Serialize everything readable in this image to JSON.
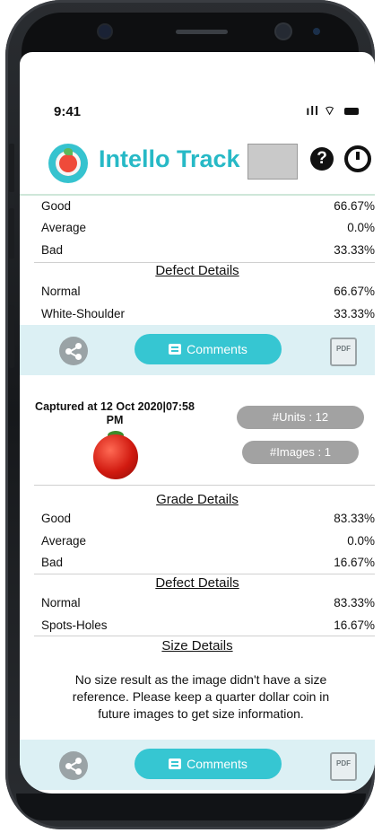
{
  "status_bar": {
    "time": "9:41",
    "signal": "ıll",
    "wifi": "⌔"
  },
  "header": {
    "app_title": "Intello Track",
    "help": "?"
  },
  "card1": {
    "grade_rows": [
      {
        "label": "Good",
        "value": "66.67%"
      },
      {
        "label": "Average",
        "value": "0.0%"
      },
      {
        "label": "Bad",
        "value": "33.33%"
      }
    ],
    "defect_title": "Defect Details",
    "defect_rows": [
      {
        "label": "Normal",
        "value": "66.67%"
      },
      {
        "label": "White-Shoulder",
        "value": "33.33%"
      }
    ],
    "comments_label": "Comments",
    "pdf_label": "PDF"
  },
  "card2": {
    "captured": "Captured at 12 Oct 2020|07:58 PM",
    "units": "#Units : 12",
    "images": "#Images : 1",
    "grade_title": "Grade Details",
    "grade_rows": [
      {
        "label": "Good",
        "value": "83.33%"
      },
      {
        "label": "Average",
        "value": "0.0%"
      },
      {
        "label": "Bad",
        "value": "16.67%"
      }
    ],
    "defect_title": "Defect Details",
    "defect_rows": [
      {
        "label": "Normal",
        "value": "83.33%"
      },
      {
        "label": "Spots-Holes",
        "value": "16.67%"
      }
    ],
    "size_title": "Size Details",
    "size_message": "No size result as the image didn't have a size reference. Please keep a quarter dollar coin in future images to get size information.",
    "comments_label": "Comments",
    "pdf_label": "PDF"
  },
  "colors": {
    "accent": "#36c6d2",
    "title": "#27b9c6",
    "action_bg": "#dcf0f4"
  }
}
